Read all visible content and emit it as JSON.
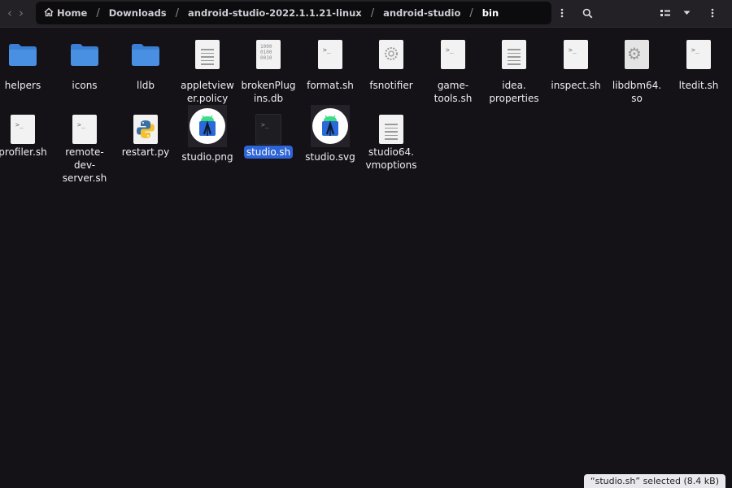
{
  "header": {
    "back_icon": "chevron-left-icon",
    "forward_icon": "chevron-right-icon",
    "breadcrumb": [
      {
        "label": "Home",
        "icon": "home-icon"
      },
      {
        "label": "Downloads"
      },
      {
        "label": "android-studio-2022.1.1.21-linux"
      },
      {
        "label": "android-studio"
      },
      {
        "label": "bin"
      }
    ],
    "separator": "/",
    "menu_icon": "vertical-dots-icon",
    "search_icon": "search-icon",
    "view_icon": "view-options-icon",
    "dropdown_icon": "chevron-down-icon",
    "window_menu_icon": "vertical-dots-icon"
  },
  "files": [
    {
      "name": "helpers",
      "kind": "folder"
    },
    {
      "name": "icons",
      "kind": "folder"
    },
    {
      "name": "lldb",
      "kind": "folder"
    },
    {
      "name": "appletviewer.policy",
      "kind": "text"
    },
    {
      "name": "brokenPlugins.db",
      "kind": "binary"
    },
    {
      "name": "format.sh",
      "kind": "script"
    },
    {
      "name": "fsnotifier",
      "kind": "executable"
    },
    {
      "name": "game-tools.sh",
      "kind": "script"
    },
    {
      "name": "idea.properties",
      "kind": "text"
    },
    {
      "name": "inspect.sh",
      "kind": "script"
    },
    {
      "name": "libdbm64.so",
      "kind": "library"
    },
    {
      "name": "ltedit.sh",
      "kind": "script"
    },
    {
      "name": "profiler.sh",
      "kind": "script"
    },
    {
      "name": "remote-dev-server.sh",
      "kind": "script"
    },
    {
      "name": "restart.py",
      "kind": "python"
    },
    {
      "name": "studio.png",
      "kind": "image"
    },
    {
      "name": "studio.sh",
      "kind": "script",
      "selected": true
    },
    {
      "name": "studio.svg",
      "kind": "image"
    },
    {
      "name": "studio64.vmoptions",
      "kind": "text"
    }
  ],
  "labels": [
    "helpers",
    "icons",
    "lldb",
    "appletview\ner.policy",
    "brokenPlug\nins.db",
    "format.sh",
    "fsnotifier",
    "game-\ntools.sh",
    "idea.\nproperties",
    "inspect.sh",
    "libdbm64.\nso",
    "ltedit.sh",
    "profiler.sh",
    "remote-\ndev-\nserver.sh",
    "restart.py",
    "studio.png",
    "studio.sh",
    "studio.svg",
    "studio64.\nvmoptions"
  ],
  "status": "“studio.sh” selected  (8.4 kB)",
  "colors": {
    "background": "#141216",
    "folder": "#4a90e2",
    "selection": "#2d64d6"
  }
}
